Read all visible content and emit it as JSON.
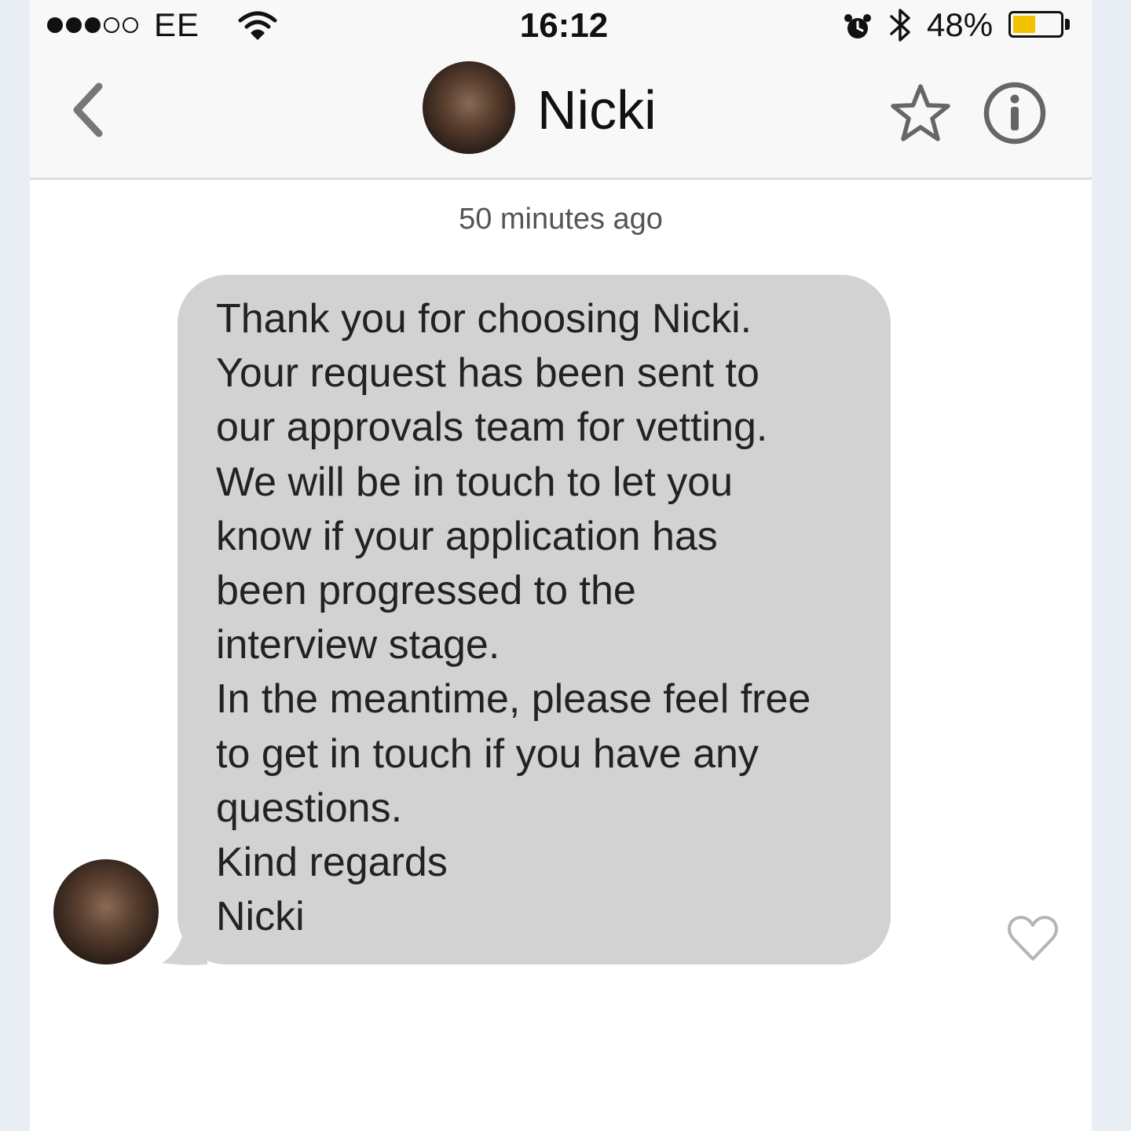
{
  "status_bar": {
    "carrier": "EE",
    "time": "16:12",
    "battery_percent": "48%",
    "battery_level": 0.48,
    "signal_bars_filled": 3,
    "signal_bars_total": 5
  },
  "header": {
    "contact_name": "Nicki",
    "icons": [
      "back-chevron-icon",
      "star-icon",
      "info-icon"
    ]
  },
  "chat": {
    "timestamp": "50 minutes ago",
    "message_lines": [
      "Thank you for choosing Nicki.",
      "Your request has been sent to",
      "our approvals team for vetting.",
      "We will be in touch to let you",
      "know if your application has",
      "been progressed to the",
      "interview stage.",
      "In the meantime, please feel free",
      "to get in touch if you have any",
      "questions.",
      "Kind regards",
      "Nicki"
    ]
  },
  "colors": {
    "bubble": "#d2d2d2",
    "header_bg": "#f8f8f8",
    "battery_fill": "#f2c200",
    "icon_gray": "#777777"
  }
}
